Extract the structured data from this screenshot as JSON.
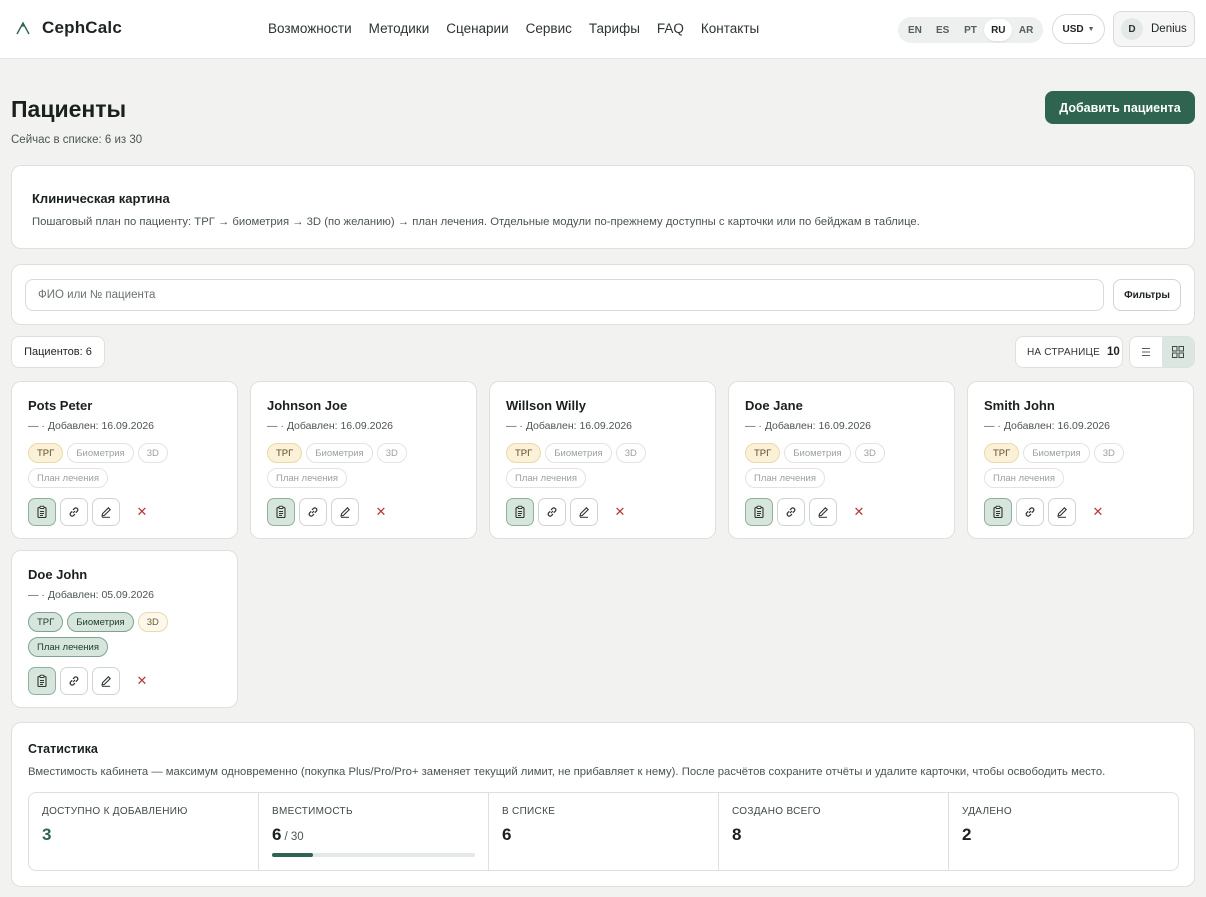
{
  "header": {
    "brand": "CephCalc",
    "nav": [
      "Возможности",
      "Методики",
      "Сценарии",
      "Сервис",
      "Тарифы",
      "FAQ",
      "Контакты"
    ],
    "languages": [
      "EN",
      "ES",
      "PT",
      "RU",
      "AR"
    ],
    "active_language": "RU",
    "currency": "USD",
    "user_initial": "D",
    "user_name": "Denius"
  },
  "page": {
    "title": "Пациенты",
    "subtitle": "Сейчас в списке: 6 из 30",
    "add_button": "Добавить пациента"
  },
  "clinical": {
    "title": "Клиническая картина",
    "text": "Пошаговый план по пациенту: ТРГ → биометрия → 3D (по желанию) → план лечения. Отдельные модули по-прежнему доступны с карточки или по бейджам в таблице."
  },
  "search": {
    "placeholder": "ФИО или № пациента",
    "filters_button": "Фильтры"
  },
  "list_controls": {
    "count_label": "Пациентов: 6",
    "per_page_label": "НА СТРАНИЦЕ",
    "per_page_value": "10"
  },
  "patients": [
    {
      "name": "Pots Peter",
      "date": "— · Добавлен: 16.09.2026",
      "badges": [
        {
          "label": "ТРГ",
          "state": "amber"
        },
        {
          "label": "Биометрия",
          "state": "off"
        },
        {
          "label": "3D",
          "state": "off"
        },
        {
          "label": "План лечения",
          "state": "off"
        }
      ]
    },
    {
      "name": "Johnson Joe",
      "date": "— · Добавлен: 16.09.2026",
      "badges": [
        {
          "label": "ТРГ",
          "state": "amber"
        },
        {
          "label": "Биометрия",
          "state": "off"
        },
        {
          "label": "3D",
          "state": "off"
        },
        {
          "label": "План лечения",
          "state": "off"
        }
      ]
    },
    {
      "name": "Willson Willy",
      "date": "— · Добавлен: 16.09.2026",
      "badges": [
        {
          "label": "ТРГ",
          "state": "amber"
        },
        {
          "label": "Биометрия",
          "state": "off"
        },
        {
          "label": "3D",
          "state": "off"
        },
        {
          "label": "План лечения",
          "state": "off"
        }
      ]
    },
    {
      "name": "Doe Jane",
      "date": "— · Добавлен: 16.09.2026",
      "badges": [
        {
          "label": "ТРГ",
          "state": "amber"
        },
        {
          "label": "Биометрия",
          "state": "off"
        },
        {
          "label": "3D",
          "state": "off"
        },
        {
          "label": "План лечения",
          "state": "off"
        }
      ]
    },
    {
      "name": "Smith John",
      "date": "— · Добавлен: 16.09.2026",
      "badges": [
        {
          "label": "ТРГ",
          "state": "amber"
        },
        {
          "label": "Биометрия",
          "state": "off"
        },
        {
          "label": "3D",
          "state": "off"
        },
        {
          "label": "План лечения",
          "state": "off"
        }
      ]
    },
    {
      "name": "Doe John",
      "date": "— · Добавлен: 05.09.2026",
      "badges": [
        {
          "label": "ТРГ",
          "state": "green"
        },
        {
          "label": "Биометрия",
          "state": "green"
        },
        {
          "label": "3D",
          "state": "amber-light"
        },
        {
          "label": "План лечения",
          "state": "green"
        }
      ]
    }
  ],
  "stats": {
    "title": "Статистика",
    "text": "Вместимость кабинета — максимум одновременно (покупка Plus/Pro/Pro+ заменяет текущий лимит, не прибавляет к нему). После расчётов сохраните отчёты и удалите карточки, чтобы освободить место.",
    "items": [
      {
        "label": "ДОСТУПНО К ДОБАВЛЕНИЮ",
        "value": "3",
        "suffix": ""
      },
      {
        "label": "ВМЕСТИМОСТЬ",
        "value": "6",
        "suffix": "/ 30"
      },
      {
        "label": "В СПИСКЕ",
        "value": "6",
        "suffix": ""
      },
      {
        "label": "СОЗДАНО ВСЕГО",
        "value": "8",
        "suffix": ""
      },
      {
        "label": "УДАЛЕНО",
        "value": "2",
        "suffix": ""
      }
    ],
    "capacity_used_fraction": 0.2
  },
  "colors": {
    "accent": "#2e6450",
    "badge_amber": "#fbf1d8",
    "badge_green": "#d6e6dd",
    "delete": "#b33a3a"
  }
}
